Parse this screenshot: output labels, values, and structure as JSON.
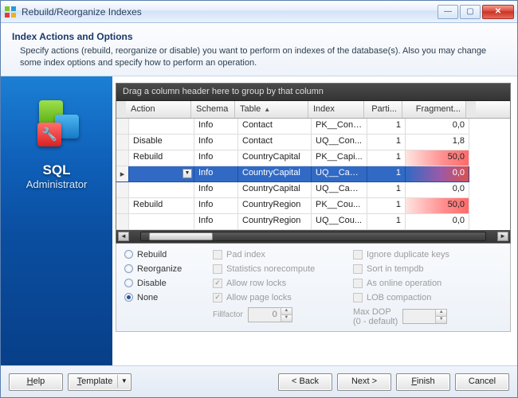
{
  "window": {
    "title": "Rebuild/Reorganize Indexes"
  },
  "header": {
    "heading": "Index Actions and Options",
    "description": "Specify actions (rebuild, reorganize or disable) you want to perform on indexes of the database(s). Also you may change some index options and specify how to perform an operation."
  },
  "sidebar": {
    "line1": "SQL",
    "line2": "Administrator"
  },
  "grid": {
    "group_hint": "Drag a column header here to group by that column",
    "columns": {
      "action": "Action",
      "schema": "Schema",
      "table": "Table",
      "index": "Index",
      "partition": "Parti...",
      "fragment": "Fragment..."
    },
    "rows": [
      {
        "action": "",
        "schema": "Info",
        "table": "Contact",
        "index": "PK__Cont...",
        "part": "1",
        "frag": "0,0",
        "high": false
      },
      {
        "action": "Disable",
        "schema": "Info",
        "table": "Contact",
        "index": "UQ__Con...",
        "part": "1",
        "frag": "1,8",
        "high": false
      },
      {
        "action": "Rebuild",
        "schema": "Info",
        "table": "CountryCapital",
        "index": "PK__Capi...",
        "part": "1",
        "frag": "50,0",
        "high": true
      },
      {
        "action": "",
        "schema": "Info",
        "table": "CountryCapital",
        "index": "UQ__Capi...",
        "part": "1",
        "frag": "0,0",
        "high": false,
        "selected": true
      },
      {
        "action": "",
        "schema": "Info",
        "table": "CountryCapital",
        "index": "UQ__Capi...",
        "part": "1",
        "frag": "0,0",
        "high": false
      },
      {
        "action": "Rebuild",
        "schema": "Info",
        "table": "CountryRegion",
        "index": "PK__Cou...",
        "part": "1",
        "frag": "50,0",
        "high": true
      },
      {
        "action": "",
        "schema": "Info",
        "table": "CountryRegion",
        "index": "UQ__Cou...",
        "part": "1",
        "frag": "0,0",
        "high": false
      }
    ]
  },
  "options": {
    "radios": {
      "rebuild": "Rebuild",
      "reorganize": "Reorganize",
      "disable": "Disable",
      "none": "None",
      "selected": "none"
    },
    "checks": {
      "pad_index": "Pad index",
      "stats": "Statistics norecompute",
      "row_locks": "Allow row locks",
      "page_locks": "Allow page locks",
      "ignore_dup": "Ignore duplicate keys",
      "tempdb": "Sort in tempdb",
      "online": "As online operation",
      "lob": "LOB compaction"
    },
    "fillfactor": {
      "label": "Fillfactor",
      "value": "0"
    },
    "maxdop": {
      "label": "Max DOP",
      "sub": "(0 - default)",
      "value": ""
    }
  },
  "footer": {
    "help": "Help",
    "template": "Template",
    "back": "< Back",
    "next": "Next >",
    "finish": "Finish",
    "cancel": "Cancel"
  }
}
